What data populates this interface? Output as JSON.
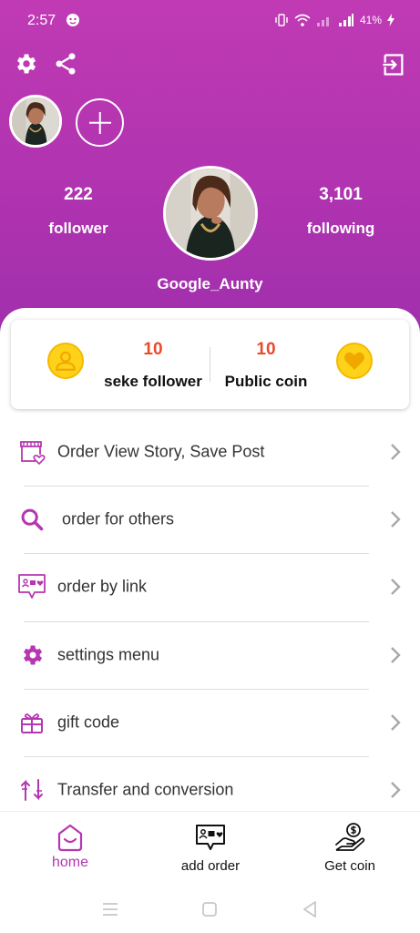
{
  "status_bar": {
    "time": "2:57",
    "battery": "41%"
  },
  "header": {
    "settings_icon": "gear-icon",
    "share_icon": "share-icon",
    "logout_icon": "exit-icon"
  },
  "profile": {
    "followers_count": "222",
    "followers_label": "follower",
    "following_count": "3,101",
    "following_label": "following",
    "username": "Google_Aunty"
  },
  "coins": {
    "seke_value": "10",
    "seke_label": "seke follower",
    "public_value": "10",
    "public_label": "Public coin"
  },
  "menu": [
    {
      "label": "Order View Story, Save Post",
      "icon": "store-heart-icon"
    },
    {
      "label": "order for others",
      "icon": "search-icon"
    },
    {
      "label": "order by link",
      "icon": "chat-order-icon"
    },
    {
      "label": "settings menu",
      "icon": "gear-icon"
    },
    {
      "label": "gift code",
      "icon": "gift-icon"
    },
    {
      "label": "Transfer and conversion",
      "icon": "transfer-icon"
    }
  ],
  "bottom_nav": {
    "home": "home",
    "add_order": "add order",
    "get_coin": "Get coin"
  },
  "colors": {
    "accent": "#b536b1",
    "coin_value": "#e84a2a",
    "coin_yellow": "#ffd21a"
  }
}
